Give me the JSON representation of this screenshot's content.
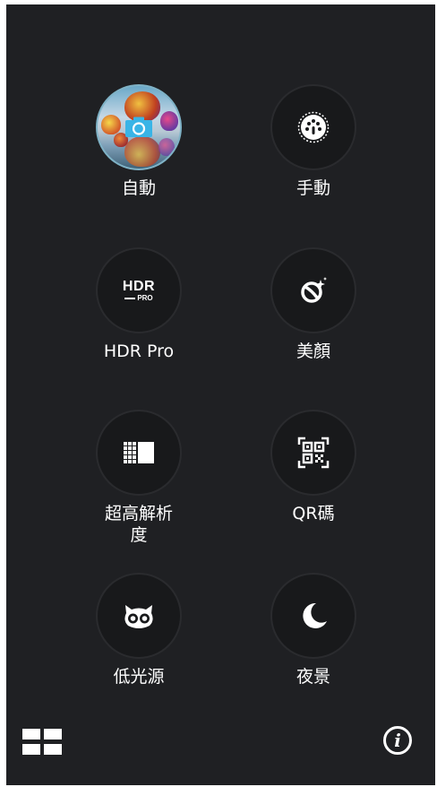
{
  "modes": [
    {
      "id": "auto",
      "label": "自動",
      "icon": "camera-icon",
      "active": true
    },
    {
      "id": "manual",
      "label": "手動",
      "icon": "dial-icon",
      "active": false
    },
    {
      "id": "hdr",
      "label": "HDR Pro",
      "icon": "hdr-pro-icon",
      "icon_text_main": "HDR",
      "icon_text_sub": "PRO",
      "active": false
    },
    {
      "id": "beauty",
      "label": "美顏",
      "icon": "beautify-sparkle-icon",
      "active": false
    },
    {
      "id": "super-res",
      "label": "超高解析\n度",
      "icon": "super-resolution-grid-icon",
      "active": false
    },
    {
      "id": "qr",
      "label": "QR碼",
      "icon": "qr-code-icon",
      "active": false
    },
    {
      "id": "low-light",
      "label": "低光源",
      "icon": "owl-icon",
      "active": false
    },
    {
      "id": "night",
      "label": "夜景",
      "icon": "moon-icon",
      "active": false
    }
  ],
  "bottom_bar": {
    "left_icon": "grid-layout-icon",
    "right_icon": "info-icon",
    "right_icon_glyph": "i"
  },
  "colors": {
    "background": "#1f2023",
    "circle_bg": "#18191b",
    "active_ring": "#7fb2c6",
    "camera_accent": "#39b4e6",
    "text": "#ffffff"
  }
}
